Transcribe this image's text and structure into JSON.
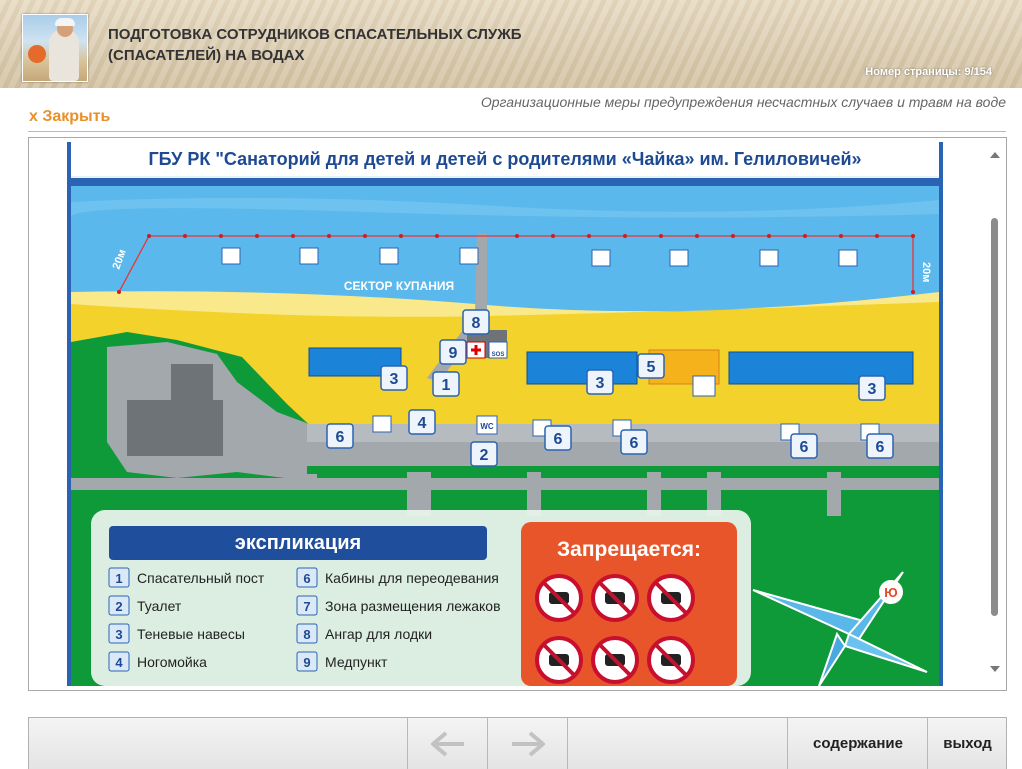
{
  "header": {
    "title": "ПОДГОТОВКА СОТРУДНИКОВ СПАСАТЕЛЬНЫХ СЛУЖБ (СПАСАТЕЛЕЙ) НА ВОДАХ",
    "page_label": "Номер страницы: 9/154"
  },
  "subtitle": "Организационные меры предупреждения несчастных случаев и травм на воде",
  "close_label": "x Закрыть",
  "map": {
    "title": "ГБУ РК \"Санаторий для детей и детей с родителями «Чайка» им. Гелиловичей»",
    "swim_sector": "СЕКТОР КУПАНИЯ",
    "distance_left": "20м",
    "distance_right": "20м",
    "wc_label": "WC",
    "sos_label": "SOS",
    "compass_label": "Ю",
    "markers": [
      "8",
      "9",
      "3",
      "1",
      "3",
      "5",
      "3",
      "4",
      "2",
      "6",
      "6",
      "6",
      "6",
      "6"
    ],
    "legend_title": "экспликация",
    "legend": [
      {
        "num": "1",
        "text": "Спасательный пост"
      },
      {
        "num": "2",
        "text": "Туалет"
      },
      {
        "num": "3",
        "text": "Теневые навесы"
      },
      {
        "num": "4",
        "text": "Ногомойка"
      },
      {
        "num": "6",
        "text": "Кабины для переодевания"
      },
      {
        "num": "7",
        "text": "Зона размещения лежаков"
      },
      {
        "num": "8",
        "text": "Ангар для лодки"
      },
      {
        "num": "9",
        "text": "Медпункт"
      }
    ],
    "forbidden_title": "Запрещается:",
    "forbidden_icons": [
      "no-smoking-icon",
      "no-tent-icon",
      "no-dogs-icon",
      "no-fire-icon",
      "no-alcohol-icon",
      "no-cars-icon"
    ],
    "colors": {
      "sea": "#5bb8ec",
      "sand": "#f4d22c",
      "grass": "#0f9a3a",
      "path": "#a3a8ad",
      "header": "#1f4f9c",
      "forbidden_bg": "#e8552a"
    }
  },
  "footer": {
    "prev_icon": "arrow-left-icon",
    "next_icon": "arrow-right-icon",
    "contents_label": "содержание",
    "exit_label": "выход"
  }
}
